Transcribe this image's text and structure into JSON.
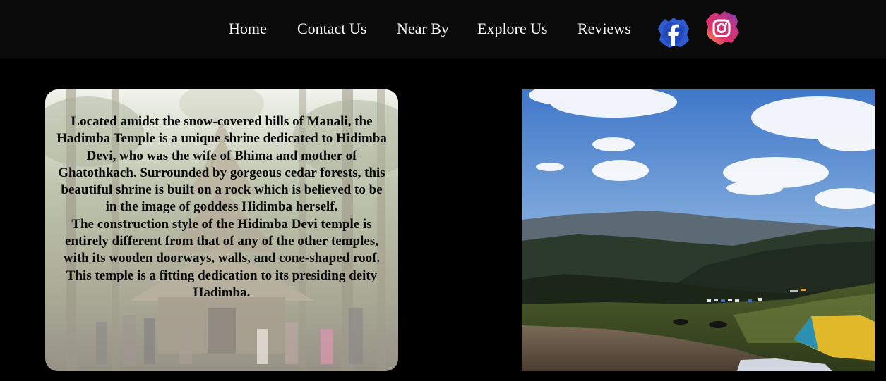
{
  "nav": {
    "items": [
      {
        "label": "Home"
      },
      {
        "label": "Contact Us"
      },
      {
        "label": "Near By"
      },
      {
        "label": "Explore Us"
      },
      {
        "label": "Reviews"
      }
    ],
    "social": {
      "facebook_icon": "facebook-icon",
      "instagram_icon": "instagram-icon"
    },
    "colors": {
      "background": "#0b0b0b",
      "text": "#ffffff"
    }
  },
  "temple_card": {
    "paragraph_1": "Located amidst the snow-covered hills of Manali, the Hadimba Temple is a unique shrine dedicated to Hidimba Devi, who was the wife of Bhima and mother of Ghatothkach. Surrounded by gorgeous cedar forests, this beautiful shrine is built on a rock which is believed to be in the image of goddess Hidimba herself.",
    "paragraph_2": "The construction style of the Hidimba Devi temple is entirely different from that of any of the other temples, with its wooden doorways, walls, and cone-shaped roof. This temple is a fitting dedication to its presiding deity Hadimba."
  },
  "page": {
    "background": "#000000"
  }
}
